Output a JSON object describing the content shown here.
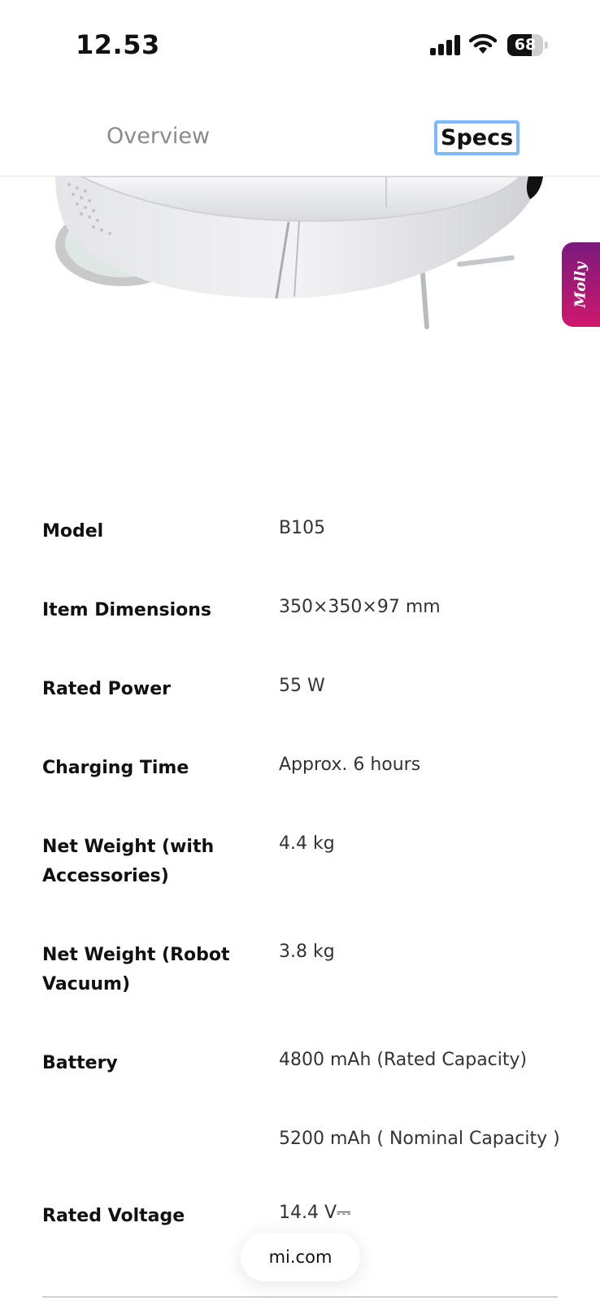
{
  "status_bar": {
    "time": "12.53",
    "battery": "68",
    "battery_level": 0.68
  },
  "tabs": [
    {
      "label": "Overview",
      "selected": false
    },
    {
      "label": "Specs",
      "selected": true
    }
  ],
  "assistant": {
    "label": "Molly"
  },
  "specs": [
    {
      "label": "Model",
      "value": "B105"
    },
    {
      "label": "Item Dimensions",
      "value": "350×350×97 mm"
    },
    {
      "label": "Rated Power",
      "value": "55 W"
    },
    {
      "label": "Charging Time",
      "value": "Approx. 6 hours"
    },
    {
      "label": "Net Weight (with Accessories)",
      "value": "4.4 kg"
    },
    {
      "label": "Net Weight (Robot Vacuum)",
      "value": "3.8 kg"
    },
    {
      "label": "Battery",
      "value": "4800 mAh (Rated Capacity)"
    },
    {
      "label": "",
      "value": "5200 mAh ( Nominal Capacity )"
    },
    {
      "label": "Rated Voltage",
      "value": "14.4 V⎓"
    }
  ],
  "footer": {
    "site": "mi.com"
  },
  "colors": {
    "tab_focus": "#7cb9ff",
    "molly_gradient_top": "#7a1a7d",
    "molly_gradient_bottom": "#d0176e"
  }
}
